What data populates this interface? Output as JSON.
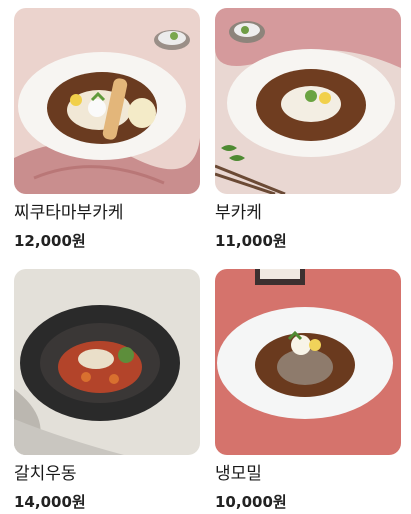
{
  "menu": {
    "items": [
      {
        "name": "찌쿠타마부카케",
        "price": "12,000원",
        "image_alt": "chikutama bukkake udon"
      },
      {
        "name": "부카케",
        "price": "11,000원",
        "image_alt": "bukkake udon"
      },
      {
        "name": "갈치우동",
        "price": "14,000원",
        "image_alt": "hairtail udon"
      },
      {
        "name": "냉모밀",
        "price": "10,000원",
        "image_alt": "cold soba"
      }
    ]
  }
}
